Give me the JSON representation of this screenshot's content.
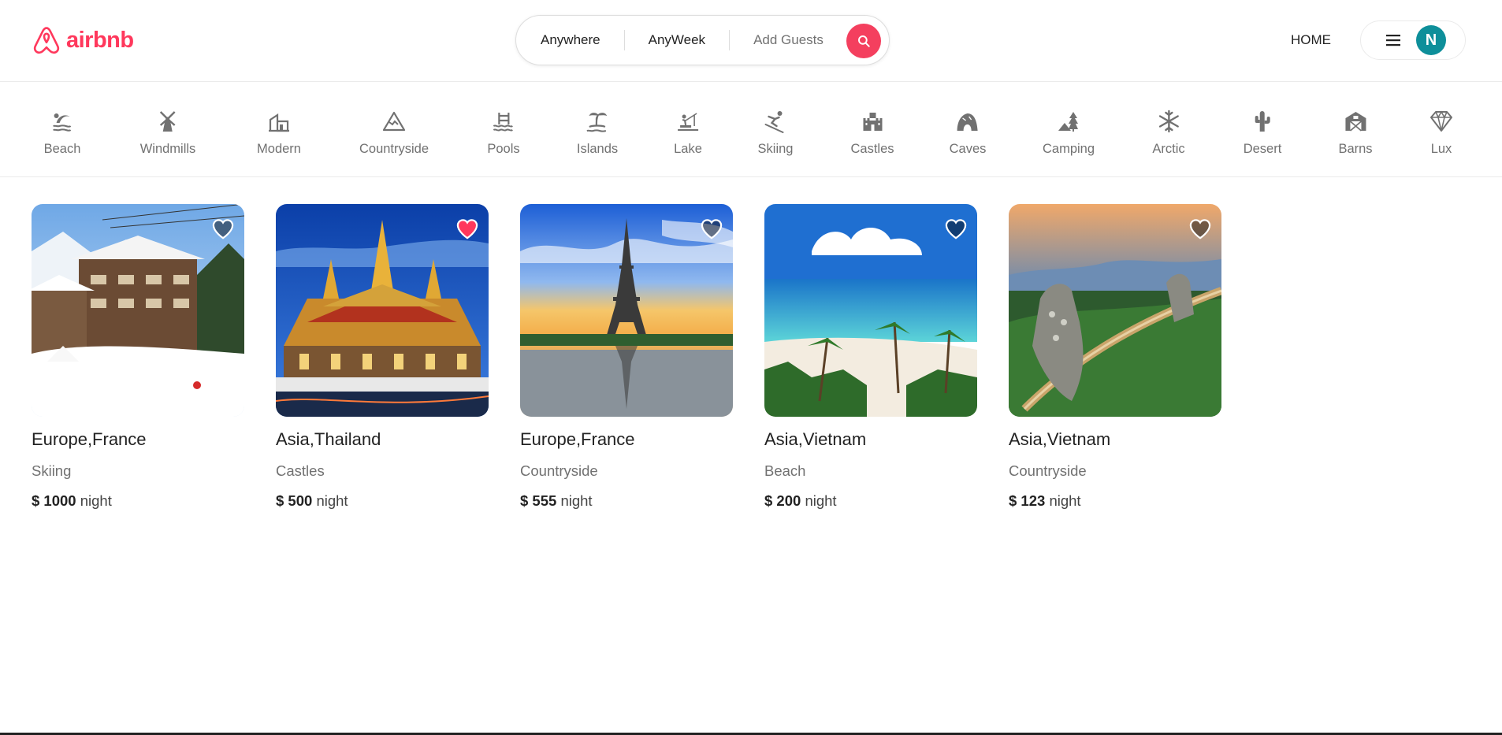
{
  "header": {
    "logo_text": "airbnb",
    "search": {
      "where": "Anywhere",
      "week": "AnyWeek",
      "guests": "Add Guests"
    },
    "home_link": "HOME",
    "avatar_initial": "N"
  },
  "categories": [
    {
      "label": "Beach",
      "icon": "beach-icon"
    },
    {
      "label": "Windmills",
      "icon": "windmill-icon"
    },
    {
      "label": "Modern",
      "icon": "modern-house-icon"
    },
    {
      "label": "Countryside",
      "icon": "mountain-icon"
    },
    {
      "label": "Pools",
      "icon": "pool-icon"
    },
    {
      "label": "Islands",
      "icon": "island-icon"
    },
    {
      "label": "Lake",
      "icon": "lake-icon"
    },
    {
      "label": "Skiing",
      "icon": "skiing-icon"
    },
    {
      "label": "Castles",
      "icon": "castle-icon"
    },
    {
      "label": "Caves",
      "icon": "cave-icon"
    },
    {
      "label": "Camping",
      "icon": "camping-icon"
    },
    {
      "label": "Arctic",
      "icon": "snowflake-icon"
    },
    {
      "label": "Desert",
      "icon": "cactus-icon"
    },
    {
      "label": "Barns",
      "icon": "barn-icon"
    },
    {
      "label": "Lux",
      "icon": "diamond-icon"
    }
  ],
  "listings": [
    {
      "location": "Europe,France",
      "category": "Skiing",
      "price": "$ 1000",
      "unit": "night",
      "favorite": false,
      "image": "ski-chalet-photo"
    },
    {
      "location": "Asia,Thailand",
      "category": "Castles",
      "price": "$ 500",
      "unit": "night",
      "favorite": true,
      "image": "thai-temple-photo"
    },
    {
      "location": "Europe,France",
      "category": "Countryside",
      "price": "$ 555",
      "unit": "night",
      "favorite": false,
      "image": "eiffel-tower-photo"
    },
    {
      "location": "Asia,Vietnam",
      "category": "Beach",
      "price": "$ 200",
      "unit": "night",
      "favorite": false,
      "image": "tropical-beach-photo"
    },
    {
      "location": "Asia,Vietnam",
      "category": "Countryside",
      "price": "$ 123",
      "unit": "night",
      "favorite": false,
      "image": "golden-bridge-photo"
    }
  ],
  "colors": {
    "brand": "#ff385c",
    "search_button": "#f43f5e",
    "avatar": "#0e8f9a",
    "heart_active": "#ff385c",
    "muted_text": "#717171"
  }
}
